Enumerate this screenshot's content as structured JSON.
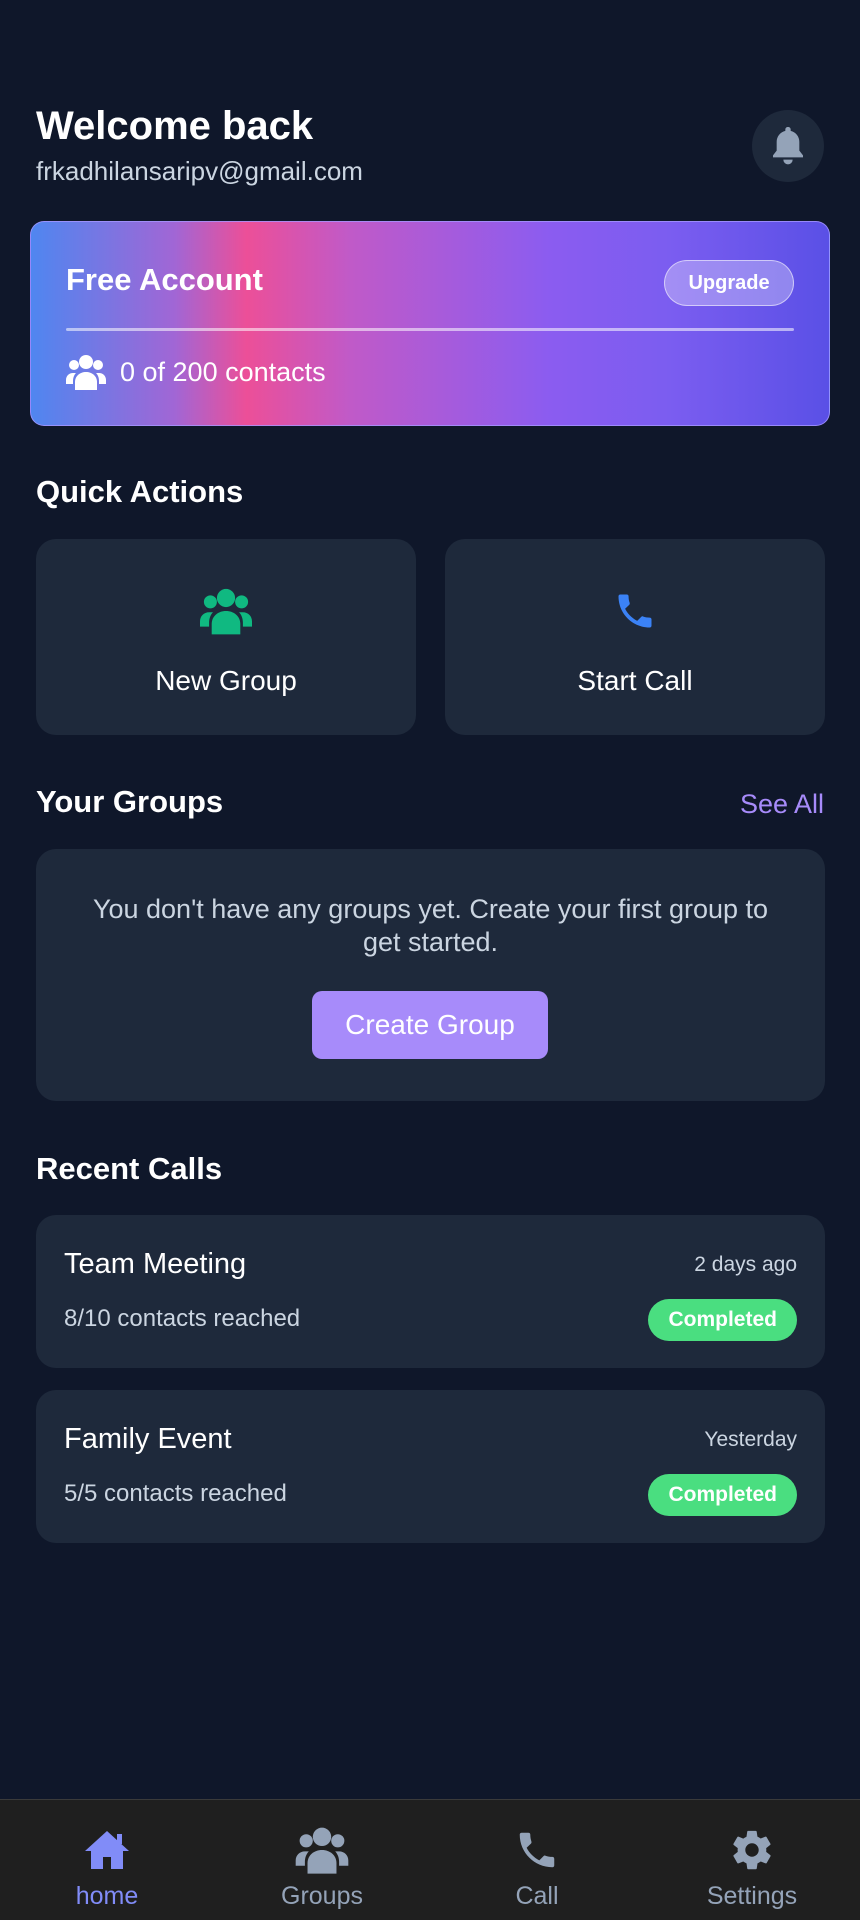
{
  "header": {
    "title": "Welcome back",
    "email": "frkadhilansaripv@gmail.com",
    "bell_icon": "bell-icon"
  },
  "account": {
    "title": "Free Account",
    "upgrade_label": "Upgrade",
    "contacts_label": "0 of 200 contacts",
    "contacts_icon": "users-icon"
  },
  "quick_actions": {
    "title": "Quick Actions",
    "items": [
      {
        "label": "New Group",
        "icon": "users-icon",
        "color": "#10b981"
      },
      {
        "label": "Start Call",
        "icon": "phone-icon",
        "color": "#3b82f6"
      }
    ]
  },
  "groups": {
    "title": "Your Groups",
    "see_all_label": "See All",
    "empty_text": "You don't have any groups yet. Create your first group to get started.",
    "create_label": "Create Group"
  },
  "recent_calls": {
    "title": "Recent Calls",
    "items": [
      {
        "name": "Team Meeting",
        "time": "2 days ago",
        "reached": "8/10 contacts reached",
        "status": "Completed"
      },
      {
        "name": "Family Event",
        "time": "Yesterday",
        "reached": "5/5 contacts reached",
        "status": "Completed"
      }
    ]
  },
  "nav": {
    "items": [
      {
        "label": "home",
        "icon": "home-icon",
        "active": true
      },
      {
        "label": "Groups",
        "icon": "users-icon",
        "active": false
      },
      {
        "label": "Call",
        "icon": "phone-icon",
        "active": false
      },
      {
        "label": "Settings",
        "icon": "gear-icon",
        "active": false
      }
    ]
  },
  "colors": {
    "background": "#0f172a",
    "card": "#1e293b",
    "accent": "#a78bfa",
    "nav_active": "#818cf8",
    "status_completed": "#4ade80"
  }
}
